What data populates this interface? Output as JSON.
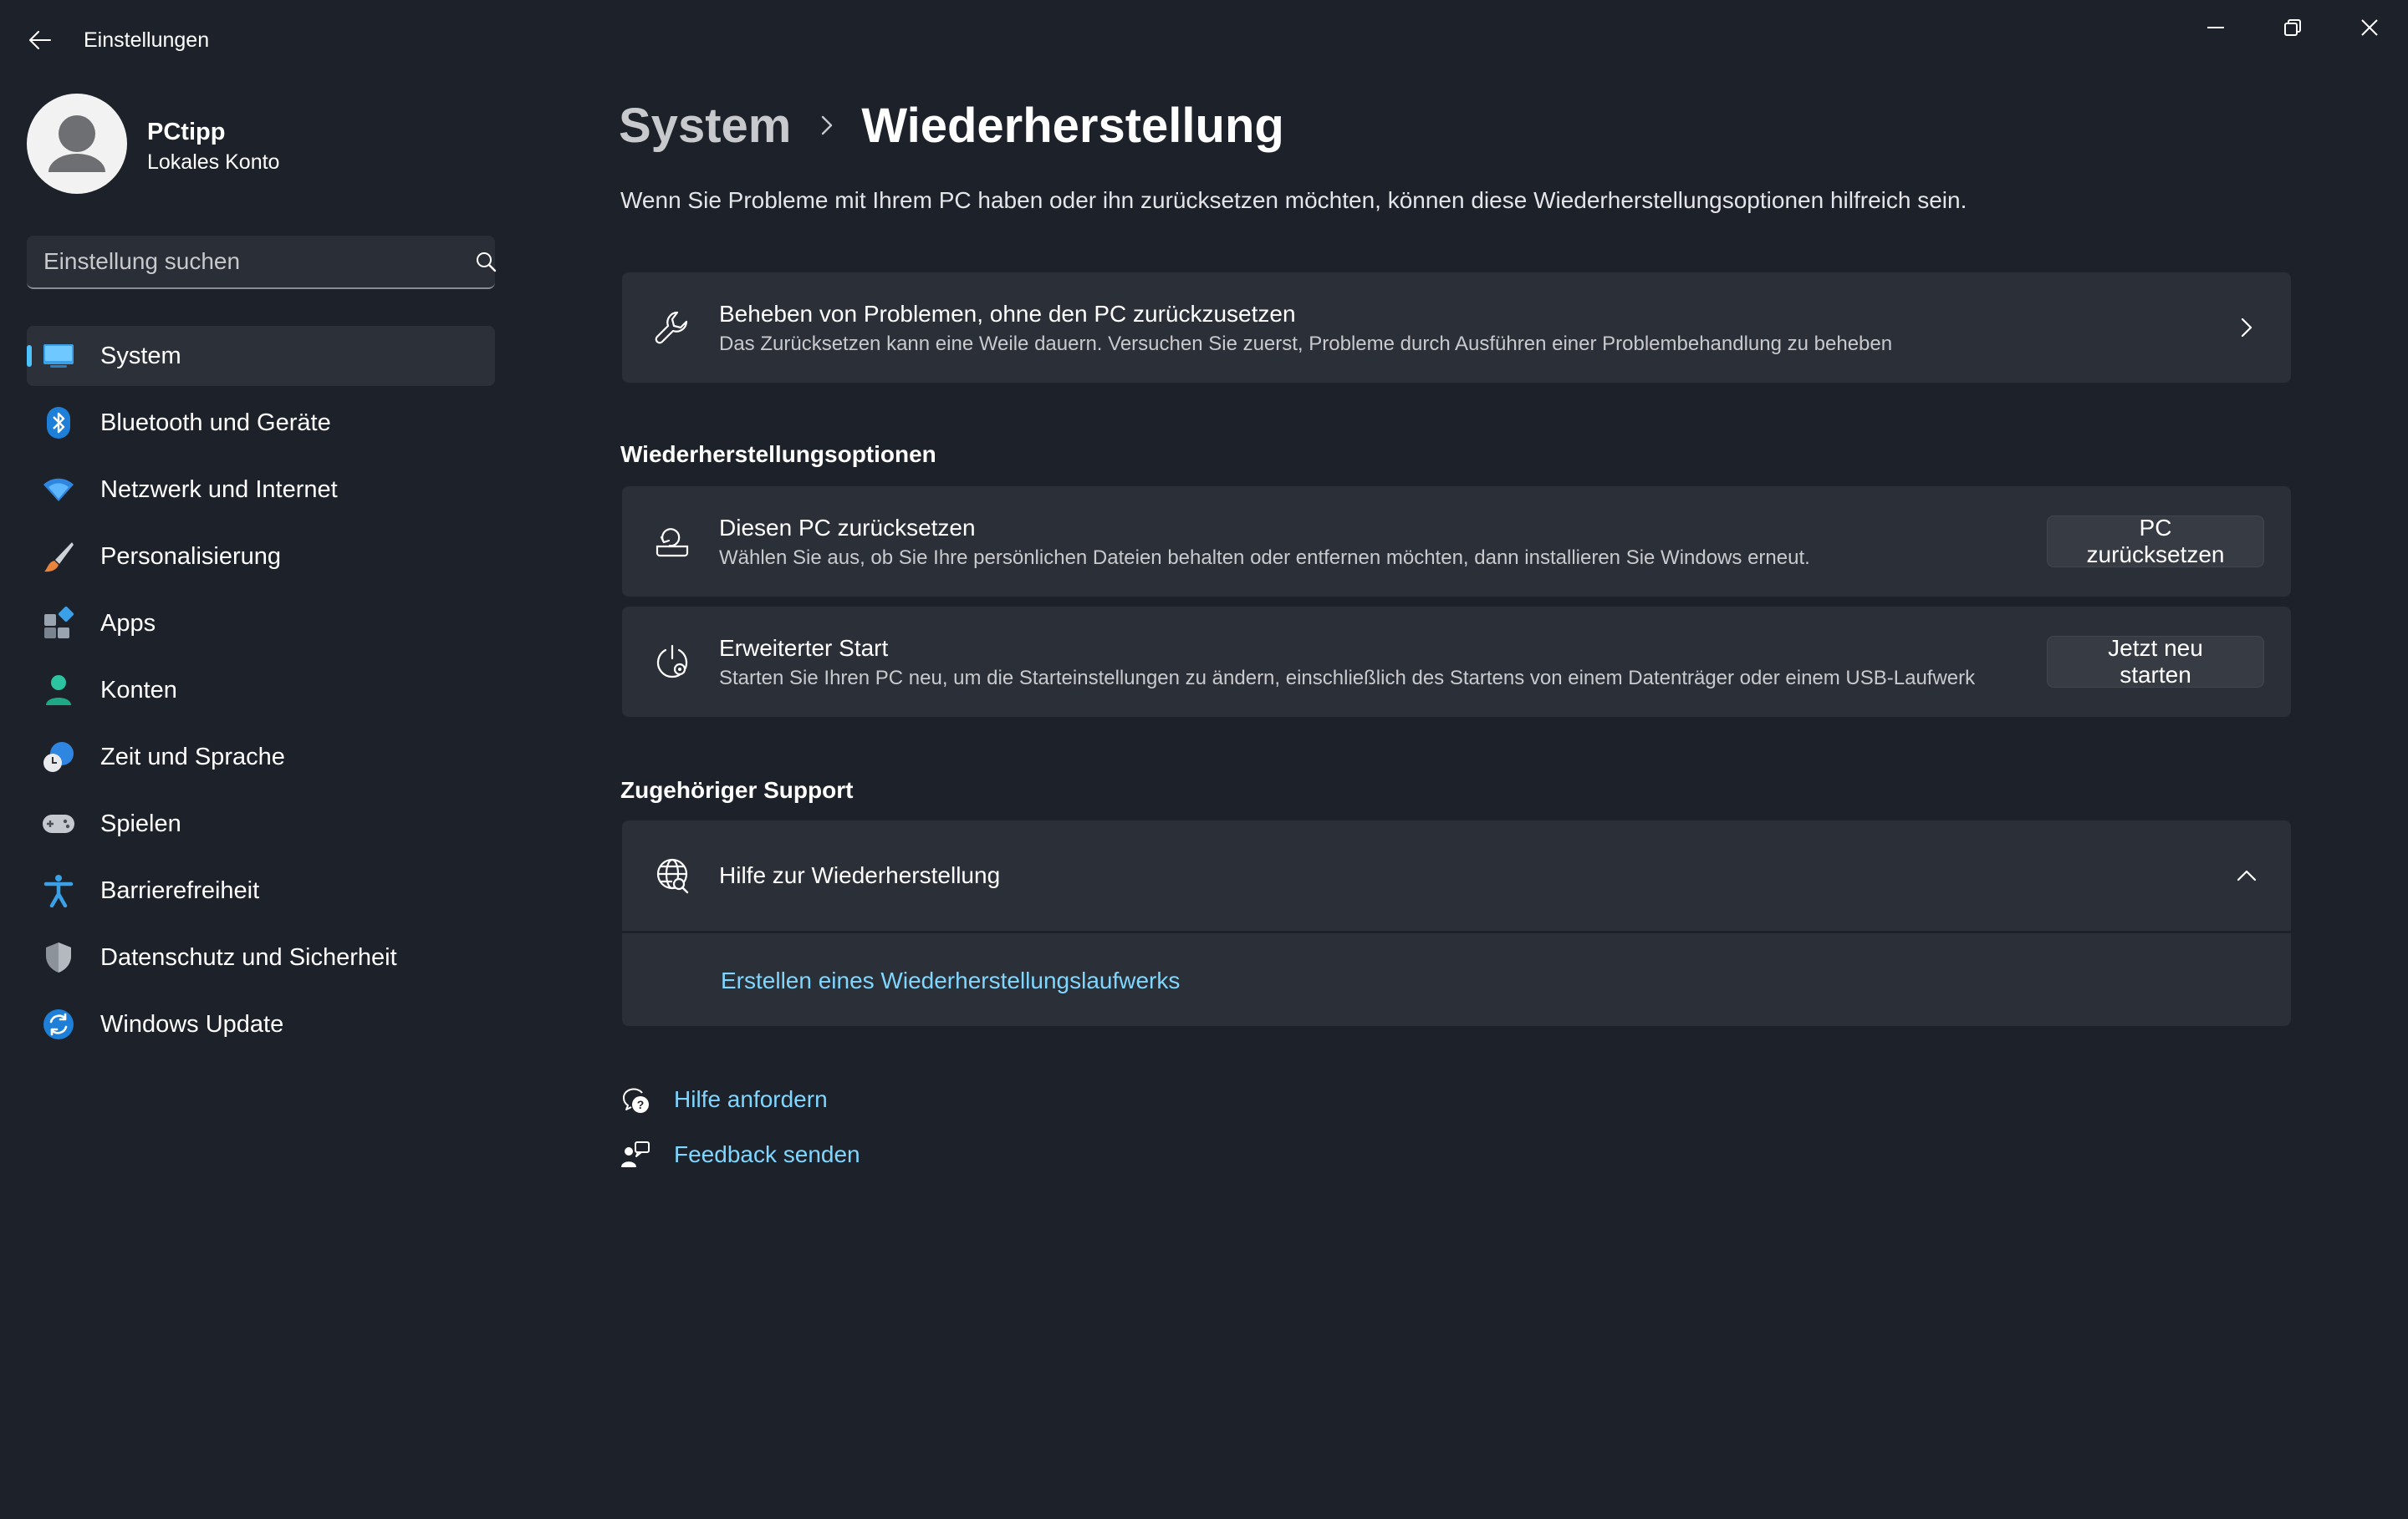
{
  "window": {
    "title": "Einstellungen"
  },
  "user": {
    "name": "PCtipp",
    "account_type": "Lokales Konto"
  },
  "search": {
    "placeholder": "Einstellung suchen"
  },
  "sidebar": {
    "items": [
      {
        "label": "System",
        "icon": "system-monitor-icon",
        "active": true
      },
      {
        "label": "Bluetooth und Geräte",
        "icon": "bluetooth-icon"
      },
      {
        "label": "Netzwerk und Internet",
        "icon": "wifi-icon"
      },
      {
        "label": "Personalisierung",
        "icon": "paintbrush-icon"
      },
      {
        "label": "Apps",
        "icon": "apps-icon"
      },
      {
        "label": "Konten",
        "icon": "person-icon"
      },
      {
        "label": "Zeit und Sprache",
        "icon": "clock-globe-icon"
      },
      {
        "label": "Spielen",
        "icon": "gamepad-icon"
      },
      {
        "label": "Barrierefreiheit",
        "icon": "accessibility-icon"
      },
      {
        "label": "Datenschutz und Sicherheit",
        "icon": "shield-icon"
      },
      {
        "label": "Windows Update",
        "icon": "refresh-icon"
      }
    ]
  },
  "main": {
    "breadcrumb": {
      "parent": "System",
      "current": "Wiederherstellung"
    },
    "intro": "Wenn Sie Probleme mit Ihrem PC haben oder ihn zurücksetzen möchten, können diese Wiederherstellungsoptionen hilfreich sein.",
    "troubleshoot_card": {
      "title": "Beheben von Problemen, ohne den PC zurückzusetzen",
      "description": "Das Zurücksetzen kann eine Weile dauern. Versuchen Sie zuerst, Probleme durch Ausführen einer Problembehandlung zu beheben"
    },
    "recovery_options": {
      "heading": "Wiederherstellungsoptionen",
      "reset": {
        "title": "Diesen PC zurücksetzen",
        "description": "Wählen Sie aus, ob Sie Ihre persönlichen Dateien behalten oder entfernen möchten, dann installieren Sie Windows erneut.",
        "button": "PC zurücksetzen"
      },
      "advanced_start": {
        "title": "Erweiterter Start",
        "description": "Starten Sie Ihren PC neu, um die Starteinstellungen zu ändern, einschließlich des Startens von einem Datenträger oder einem USB-Laufwerk",
        "button": "Jetzt neu starten"
      }
    },
    "related_support": {
      "heading": "Zugehöriger Support",
      "expander_title": "Hilfe zur Wiederherstellung",
      "expanded": true,
      "link": "Erstellen eines Wiederherstellungslaufwerks"
    },
    "footer_links": {
      "help": "Hilfe anfordern",
      "feedback": "Feedback senden"
    }
  },
  "colors": {
    "background": "#1d2129",
    "card": "#2b2f37",
    "accent": "#4cc2ff",
    "link": "#7fd6ff"
  }
}
